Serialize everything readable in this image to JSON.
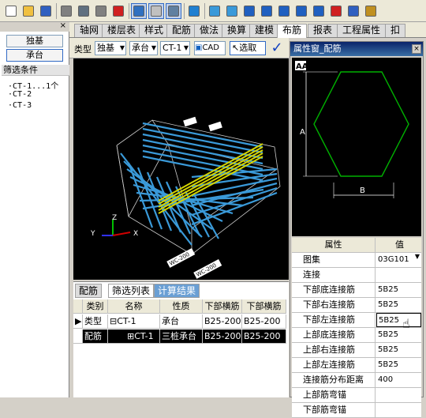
{
  "colors": {
    "accent": "#316ac5",
    "bar": "#3a9ad9",
    "highlight": "#d4d400",
    "title_bar": "#0a246a",
    "shape_green": "#00b000"
  },
  "toolbar": {
    "icons": [
      "new-file",
      "open-folder",
      "save",
      "cut",
      "copy",
      "paste",
      "delete",
      "tree-view",
      "table-view",
      "properties",
      "magic-wand",
      "grid",
      "layers",
      "shape-a",
      "shape-b",
      "shape-c",
      "shape-d",
      "shape-e",
      "magnet",
      "pin",
      "ruler"
    ]
  },
  "left_panel": {
    "close": "×",
    "type_btn": "独基",
    "sub_btn": "承台",
    "filter_label": "筛选条件",
    "tree": [
      "CT-1...1个",
      "CT-2",
      "CT-3"
    ]
  },
  "tabs": [
    "轴网",
    "楼层表",
    "样式",
    "配筋",
    "做法",
    "换算",
    "建模",
    "布筋",
    "报表",
    "工程属性",
    "扣"
  ],
  "active_tab_index": 7,
  "bar2": {
    "type_label": "类型",
    "type_value": "独基",
    "sub_value": "承台",
    "code_value": "CT-1",
    "cad_label": "CAD",
    "select_label": "选取",
    "check": "✓"
  },
  "viewport": {
    "axis_z": "Z",
    "axis_y": "Y",
    "axis_x": "X",
    "dim_a": "WC-200",
    "dim_b": "WC-200"
  },
  "bottom": {
    "tabs": [
      "配筋",
      "筛选列表",
      "计算结果"
    ],
    "active_tab_index": 1,
    "headers": [
      "类别",
      "名称",
      "性质",
      "下部横筋",
      "下部横筋"
    ],
    "rows": [
      {
        "marker": "▶",
        "cat": "类型",
        "name": "⊟CT-1",
        "prop": "承台",
        "b1": "B25-200",
        "b2": "B25-200"
      },
      {
        "marker": "",
        "cat": "配筋",
        "name": "⊞CT-1",
        "prop": "三桩承台",
        "b1": "B25-200",
        "b2": "B25-200"
      }
    ]
  },
  "property_window": {
    "title": "属性窗_配筋",
    "close": "×",
    "diagram_label_a": "A",
    "diagram_label_b": "B",
    "col_prop": "属性",
    "col_value": "值",
    "rows": [
      {
        "k": "图集",
        "v": "03G101"
      },
      {
        "k": "连接",
        "v": ""
      },
      {
        "k": "下部底连接筋",
        "v": "5B25"
      },
      {
        "k": "下部右连接筋",
        "v": "5B25"
      },
      {
        "k": "下部左连接筋",
        "v": "5B25"
      },
      {
        "k": "上部底连接筋",
        "v": "5B25"
      },
      {
        "k": "上部右连接筋",
        "v": "5B25"
      },
      {
        "k": "上部左连接筋",
        "v": "5B25"
      },
      {
        "k": "连接筋分布距离",
        "v": "400"
      },
      {
        "k": "上部筋弯锚",
        "v": ""
      },
      {
        "k": "下部筋弯锚",
        "v": ""
      }
    ]
  }
}
